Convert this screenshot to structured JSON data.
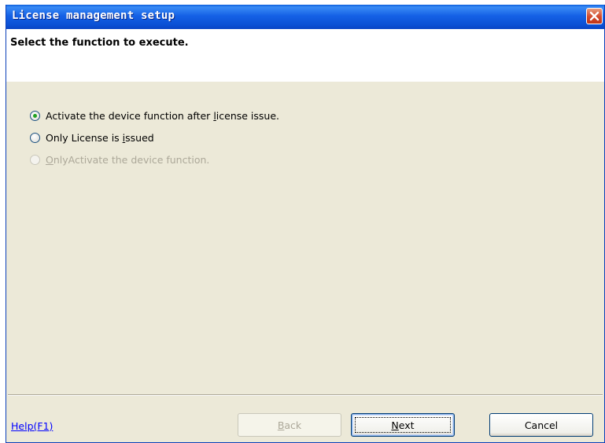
{
  "window": {
    "title": "License management setup"
  },
  "header": {
    "title": "Select the function to execute."
  },
  "options": [
    {
      "label_before": "Activate the device function after ",
      "mnemonic": "l",
      "label_after": "icense issue.",
      "checked": true,
      "enabled": true
    },
    {
      "label_before": "Only License is ",
      "mnemonic": "i",
      "label_after": "ssued",
      "checked": false,
      "enabled": true
    },
    {
      "label_before": "",
      "mnemonic": "O",
      "label_after": "nlyActivate the device function.",
      "checked": false,
      "enabled": false
    }
  ],
  "footer": {
    "help_link": "Help(F1)",
    "back": {
      "mnemonic": "B",
      "rest": "ack",
      "enabled": false
    },
    "next": {
      "mnemonic": "N",
      "rest": "ext",
      "enabled": true,
      "default": true
    },
    "cancel": {
      "label": "Cancel",
      "enabled": true
    }
  },
  "colors": {
    "title_bar": "#0a4fd3",
    "dialog_bg": "#ece9d8",
    "link": "#0000ff",
    "radio_selected": "#21a121",
    "close_button": "#d2492d"
  },
  "icons": {
    "close": "close-icon"
  }
}
